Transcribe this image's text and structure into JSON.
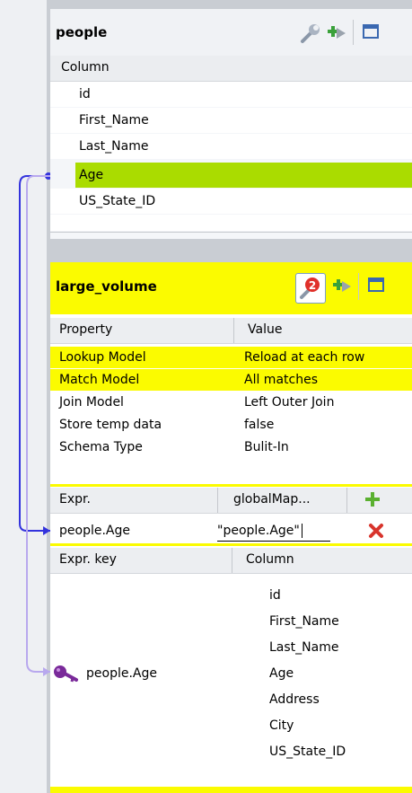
{
  "people": {
    "title": "people",
    "column_header": "Column",
    "columns": [
      "id",
      "First_Name",
      "Last_Name",
      "Age",
      "US_State_ID"
    ],
    "selected_column": "Age",
    "icons": [
      "wrench-icon",
      "add-arrow-icon",
      "window-icon"
    ]
  },
  "large_volume": {
    "title": "large_volume",
    "icons": [
      "error-badge-icon",
      "add-arrow-icon",
      "window-icon"
    ],
    "error_count": "2",
    "property_header": "Property",
    "value_header": "Value",
    "properties": [
      {
        "name": "Lookup Model",
        "value": "Reload at each row"
      },
      {
        "name": "Match Model",
        "value": "All matches"
      },
      {
        "name": "Join Model",
        "value": "Left Outer Join"
      },
      {
        "name": "Store temp data",
        "value": "false"
      },
      {
        "name": "Schema Type",
        "value": "Bulit-In"
      }
    ],
    "expr_header": "Expr.",
    "globalmap_header": "globalMap...",
    "expr_row": {
      "expr": "people.Age",
      "globalmap": "\"people.Age\""
    },
    "exprkey_header": "Expr. key",
    "column_header": "Column",
    "key_rows": [
      {
        "key": "",
        "column": "id"
      },
      {
        "key": "",
        "column": "First_Name"
      },
      {
        "key": "",
        "column": "Last_Name"
      },
      {
        "key": "people.Age",
        "column": "Age"
      },
      {
        "key": "",
        "column": "Address"
      },
      {
        "key": "",
        "column": "City"
      },
      {
        "key": "",
        "column": "US_State_ID"
      }
    ]
  },
  "colors": {
    "highlight_yellow": "#fbfb00",
    "selected_green": "#aadc00",
    "link_blue": "#3333dd",
    "link_lavender": "#b8a8ee"
  }
}
